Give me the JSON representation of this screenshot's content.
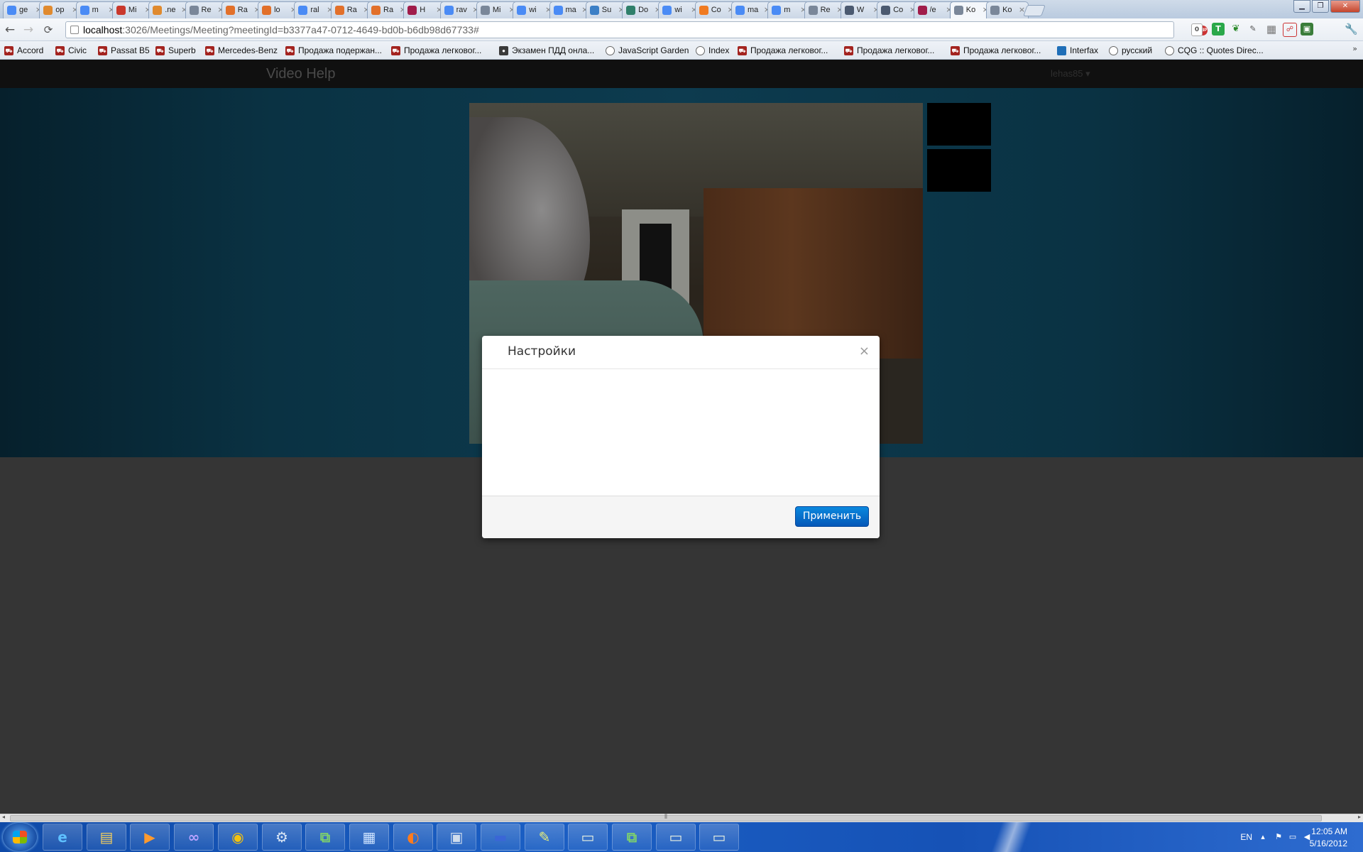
{
  "browser": {
    "tabs": [
      {
        "title": "ge",
        "icon": "google-icon"
      },
      {
        "title": "op",
        "icon": "stackoverflow-icon"
      },
      {
        "title": "m",
        "icon": "google-icon"
      },
      {
        "title": "Mi",
        "icon": "gmail-icon"
      },
      {
        "title": ".ne",
        "icon": "stackoverflow-icon"
      },
      {
        "title": "Re",
        "icon": "globe-icon"
      },
      {
        "title": "Ra",
        "icon": "habr-icon"
      },
      {
        "title": "lo",
        "icon": "habr-icon"
      },
      {
        "title": "ral",
        "icon": "google-icon"
      },
      {
        "title": "Ra",
        "icon": "habr-icon"
      },
      {
        "title": "Ra",
        "icon": "habr-icon"
      },
      {
        "title": "H",
        "icon": "bird-icon"
      },
      {
        "title": "rav",
        "icon": "google-icon"
      },
      {
        "title": "Mi",
        "icon": "globe-icon"
      },
      {
        "title": "wi",
        "icon": "google-icon"
      },
      {
        "title": "ma",
        "icon": "google-icon"
      },
      {
        "title": "Su",
        "icon": "chat-icon"
      },
      {
        "title": "Do",
        "icon": "pattern-icon"
      },
      {
        "title": "wi",
        "icon": "google-icon"
      },
      {
        "title": "Co",
        "icon": "blogger-icon"
      },
      {
        "title": "ma",
        "icon": "google-icon"
      },
      {
        "title": "m",
        "icon": "google-icon"
      },
      {
        "title": "Re",
        "icon": "globe-icon"
      },
      {
        "title": "W",
        "icon": "book-icon"
      },
      {
        "title": "Co",
        "icon": "book-icon"
      },
      {
        "title": "/e",
        "icon": "bird-icon"
      },
      {
        "title": "Ko",
        "icon": "globe-icon",
        "active": true
      },
      {
        "title": "Ko",
        "icon": "globe-icon"
      }
    ],
    "url": {
      "host": "localhost",
      "path": ":3026/Meetings/Meeting?meetingId=b3377a47-0712-4649-bd0b-b6db98d67733#"
    },
    "extensions": {
      "abp": "ABP",
      "counter": "0",
      "trello_letter": "T"
    },
    "bookmarks": [
      {
        "label": "Accord",
        "icon": "car-icon"
      },
      {
        "label": "Civic",
        "icon": "car-icon"
      },
      {
        "label": "Passat B5",
        "icon": "car-icon"
      },
      {
        "label": "Superb",
        "icon": "car-icon"
      },
      {
        "label": "Mercedes-Benz",
        "icon": "car-icon"
      },
      {
        "label": "Продажа подержан...",
        "icon": "car-icon"
      },
      {
        "label": "Продажа легковог...",
        "icon": "car-icon"
      },
      {
        "label": "Экзамен ПДД онла...",
        "icon": "traffic-light-icon"
      },
      {
        "label": "JavaScript Garden",
        "icon": "globe-icon"
      },
      {
        "label": "Index",
        "icon": "globe-icon"
      },
      {
        "label": "Продажа легковог...",
        "icon": "car-icon"
      },
      {
        "label": "Продажа легковог...",
        "icon": "car-icon"
      },
      {
        "label": "Продажа легковог...",
        "icon": "car-icon"
      },
      {
        "label": "Interfax",
        "icon": "trello-icon"
      },
      {
        "label": "русский",
        "icon": "globe-icon"
      },
      {
        "label": "CQG :: Quotes Direc...",
        "icon": "globe-icon"
      }
    ],
    "bookmarks_more": "»"
  },
  "app": {
    "brand": "Video Help",
    "user": "lehas85 ▾"
  },
  "modal": {
    "title": "Настройки",
    "close": "×",
    "apply_label": "Применить"
  },
  "taskbar": {
    "items": [
      {
        "name": "internet-explorer",
        "glyph": "e",
        "color": "#5ec0ff"
      },
      {
        "name": "file-explorer",
        "glyph": "▤",
        "color": "#f5cf5c"
      },
      {
        "name": "media-player",
        "glyph": "▶",
        "color": "#ff9a2e"
      },
      {
        "name": "visual-studio",
        "glyph": "∞",
        "color": "#b9a3ff"
      },
      {
        "name": "chrome",
        "glyph": "◉",
        "color": "#f4c20d"
      },
      {
        "name": "settings-app",
        "glyph": "⚙",
        "color": "#d9e6f5"
      },
      {
        "name": "vs-tool",
        "glyph": "⧉",
        "color": "#7fd26b"
      },
      {
        "name": "sql-tool",
        "glyph": "▦",
        "color": "#cfe4ff"
      },
      {
        "name": "firefox",
        "glyph": "◐",
        "color": "#ff7b1c"
      },
      {
        "name": "network-tool",
        "glyph": "▣",
        "color": "#cfdcec"
      },
      {
        "name": "save-tool",
        "glyph": "▬",
        "color": "#3a66d6"
      },
      {
        "name": "notepad-tool",
        "glyph": "✎",
        "color": "#e9f07a"
      },
      {
        "name": "window-app-1",
        "glyph": "▭",
        "color": "#e8f0e0"
      },
      {
        "name": "vs-tool-2",
        "glyph": "⧉",
        "color": "#7fd26b"
      },
      {
        "name": "window-app-2",
        "glyph": "▭",
        "color": "#e8f0e0"
      },
      {
        "name": "window-app-3",
        "glyph": "▭",
        "color": "#e8f0e0"
      }
    ],
    "language": "EN",
    "time": "12:05 AM",
    "date": "5/16/2012"
  }
}
